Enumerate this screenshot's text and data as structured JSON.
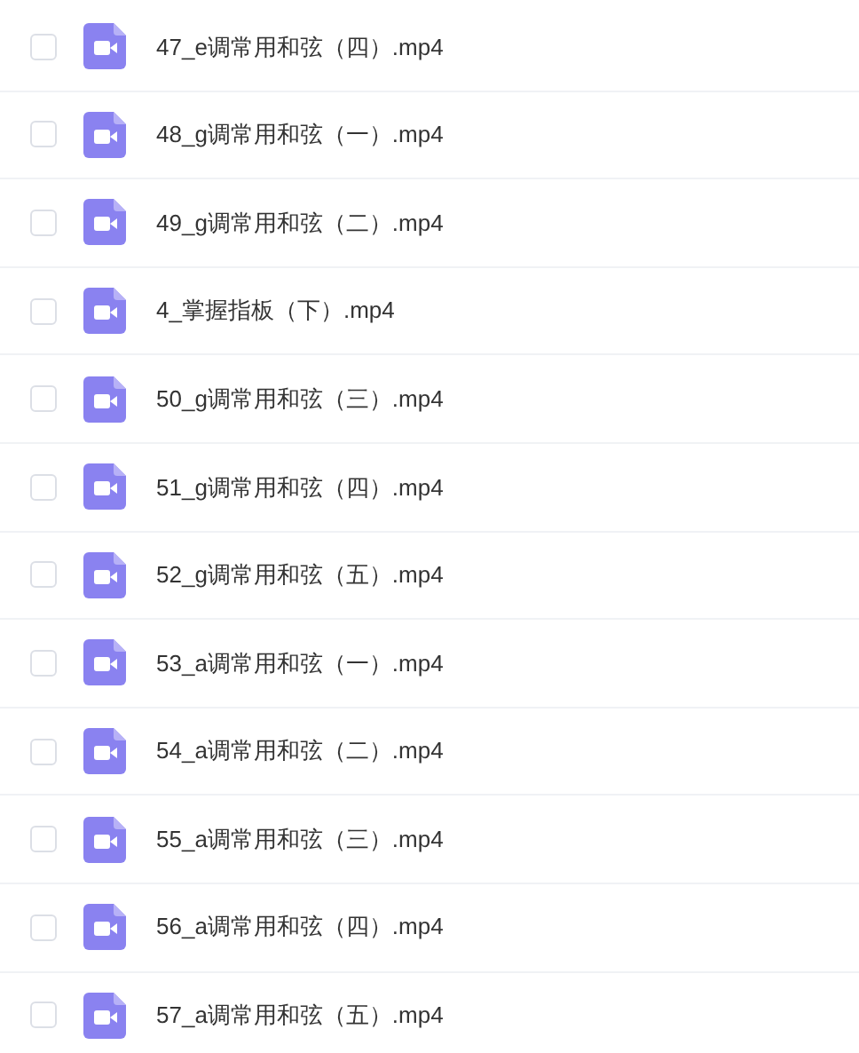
{
  "files": [
    {
      "name": "47_e调常用和弦（四）.mp4",
      "checked": false
    },
    {
      "name": "48_g调常用和弦（一）.mp4",
      "checked": false
    },
    {
      "name": "49_g调常用和弦（二）.mp4",
      "checked": false
    },
    {
      "name": "4_掌握指板（下）.mp4",
      "checked": false
    },
    {
      "name": "50_g调常用和弦（三）.mp4",
      "checked": false
    },
    {
      "name": "51_g调常用和弦（四）.mp4",
      "checked": false
    },
    {
      "name": "52_g调常用和弦（五）.mp4",
      "checked": false
    },
    {
      "name": "53_a调常用和弦（一）.mp4",
      "checked": false
    },
    {
      "name": "54_a调常用和弦（二）.mp4",
      "checked": false
    },
    {
      "name": "55_a调常用和弦（三）.mp4",
      "checked": false
    },
    {
      "name": "56_a调常用和弦（四）.mp4",
      "checked": false
    },
    {
      "name": "57_a调常用和弦（五）.mp4",
      "checked": false
    }
  ]
}
